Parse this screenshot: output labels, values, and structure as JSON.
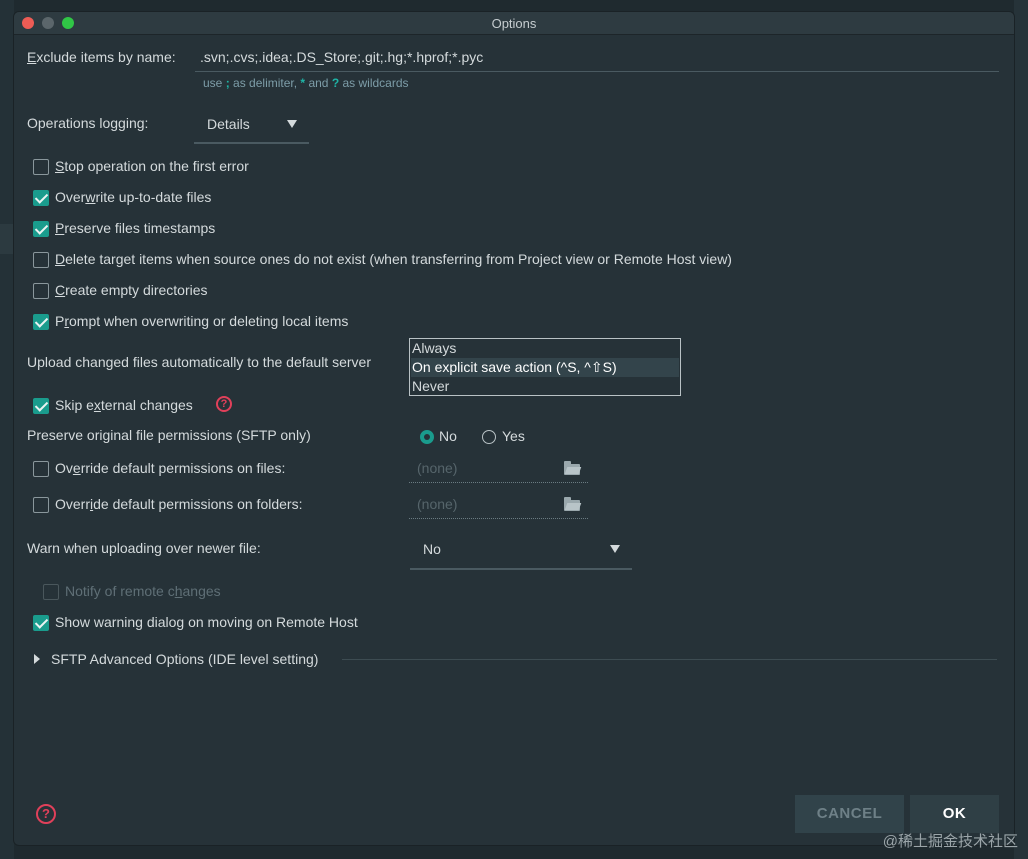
{
  "window": {
    "title": "Options"
  },
  "exclude": {
    "label_pre": "",
    "label_u": "E",
    "label_post": "xclude items by name:",
    "value": ".svn;.cvs;.idea;.DS_Store;.git;.hg;*.hprof;*.pyc",
    "hint_1": "use",
    "hint_sym1": ";",
    "hint_2": "as delimiter,",
    "hint_sym2": "*",
    "hint_3": "and",
    "hint_sym3": "?",
    "hint_4": "as wildcards"
  },
  "operations_logging": {
    "label": "Operations logging:",
    "value": "Details"
  },
  "checkboxes": [
    {
      "pre": "",
      "u": "S",
      "post": "top operation on the first error",
      "checked": false
    },
    {
      "pre": "Over",
      "u": "w",
      "post": "rite up-to-date files",
      "checked": true
    },
    {
      "pre": "",
      "u": "P",
      "post": "reserve files timestamps",
      "checked": true
    },
    {
      "pre": "",
      "u": "D",
      "post": "elete target items when source ones do not exist (when transferring from Project view or Remote Host view)",
      "checked": false
    },
    {
      "pre": "",
      "u": "C",
      "post": "reate empty directories",
      "checked": false
    },
    {
      "pre": "P",
      "u": "r",
      "post": "ompt when overwriting or deleting local items",
      "checked": true
    }
  ],
  "upload": {
    "label": "Upload changed files automatically to the default server",
    "options": [
      "Always",
      "On explicit save action (^S, ^⇧S)",
      "Never"
    ],
    "selected_index": 1
  },
  "skip_external": {
    "pre": "Skip e",
    "u": "x",
    "post": "ternal changes",
    "checked": true,
    "help": "?"
  },
  "permissions": {
    "label": "Preserve original file permissions (SFTP only)",
    "no_label": "No",
    "yes_label": "Yes",
    "selected": "No"
  },
  "override_files": {
    "pre": "Ov",
    "u": "e",
    "post": "rride default permissions on files:",
    "placeholder": "(none)",
    "checked": false
  },
  "override_folders": {
    "pre": "Overr",
    "u": "i",
    "post": "de default permissions on folders:",
    "placeholder": "(none)",
    "checked": false
  },
  "warn_newer": {
    "label": "Warn when uploading over newer file:",
    "value": "No"
  },
  "notify_remote": {
    "pre": "Notify of remote c",
    "u": "h",
    "post": "anges",
    "checked": false
  },
  "show_warning": {
    "label": "Show warning dialog on moving on Remote Host",
    "checked": true
  },
  "sftp_advanced": {
    "label": "SFTP Advanced Options (IDE level setting)"
  },
  "footer": {
    "help": "?",
    "cancel": "CANCEL",
    "ok": "OK"
  },
  "watermark": "@稀土掘金技术社区",
  "colors": {
    "accent": "#1a9c8d",
    "background": "#263238",
    "help_red": "#e0405a"
  }
}
